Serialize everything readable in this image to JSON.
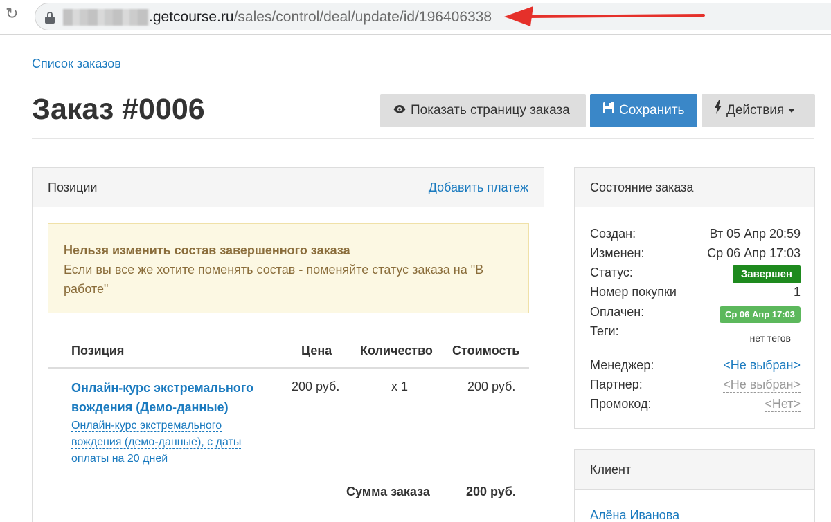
{
  "browser": {
    "url_host": ".getcourse.ru",
    "url_path": "/sales/control/deal/update/id/196406338"
  },
  "breadcrumb": "Список заказов",
  "page_title": "Заказ #0006",
  "toolbar": {
    "show_label": "Показать страницу заказа",
    "save_label": "Сохранить",
    "actions_label": "Действия"
  },
  "positions_panel": {
    "title": "Позиции",
    "add_payment": "Добавить платеж",
    "warning_title": "Нельзя изменить состав завершенного заказа",
    "warning_text": "Если вы все же хотите поменять состав - поменяйте статус заказа на \"В работе\"",
    "columns": [
      "Позиция",
      "Цена",
      "Количество",
      "Стоимость"
    ],
    "items": [
      {
        "title": "Онлайн-курс экстремального вождения (Демо-данные)",
        "description": "Онлайн-курс экстремального вождения (демо-данные), с даты оплаты на 20 дней",
        "price": "200 руб.",
        "quantity": "x 1",
        "cost": "200 руб."
      }
    ],
    "total_label": "Сумма заказа",
    "total_value": "200 руб."
  },
  "status_panel": {
    "title": "Состояние заказа",
    "created_label": "Создан:",
    "created_value": "Вт 05 Апр 20:59",
    "modified_label": "Изменен:",
    "modified_value": "Ср 06 Апр 17:03",
    "status_label": "Статус:",
    "status_value": "Завершен",
    "purchase_label": "Номер покупки",
    "purchase_value": "1",
    "paid_label": "Оплачен:",
    "paid_value": "Ср 06 Апр 17:03",
    "tags_label": "Теги:",
    "tags_value": "нет тегов",
    "manager_label": "Менеджер:",
    "manager_value": "<Не выбран>",
    "partner_label": "Партнер:",
    "partner_value": "<Не выбран>",
    "promo_label": "Промокод:",
    "promo_value": "<Нет>"
  },
  "client_panel": {
    "title": "Клиент",
    "client_name": "Алёна Иванова"
  },
  "colors": {
    "link": "#1a7abf",
    "primary_button": "#3a87c8",
    "status_done": "#1e8a1e",
    "paid_badge": "#5cb85c",
    "annotation_arrow": "#e5302a"
  },
  "icons": {
    "reload": "reload-icon",
    "lock": "lock-icon",
    "eye": "eye-icon",
    "save": "floppy-disk-icon",
    "actions": "lightning-bolt-icon"
  }
}
